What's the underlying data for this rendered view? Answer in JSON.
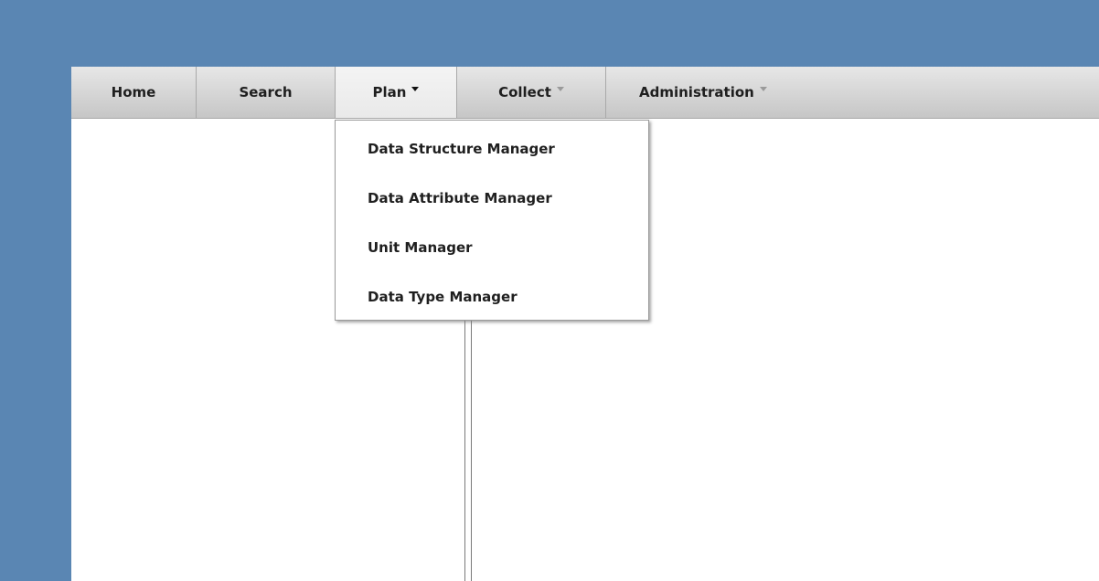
{
  "menubar": {
    "items": [
      {
        "label": "Home"
      },
      {
        "label": "Search"
      },
      {
        "label": "Plan"
      },
      {
        "label": "Collect"
      },
      {
        "label": "Administration"
      }
    ]
  },
  "dropdown": {
    "items": [
      {
        "label": "Data Structure Manager"
      },
      {
        "label": "Data Attribute Manager"
      },
      {
        "label": "Unit Manager"
      },
      {
        "label": "Data Type Manager"
      }
    ]
  },
  "icons": {
    "plan_caret": "caret-down-icon",
    "collect_caret": "caret-down-icon",
    "administration_caret": "caret-down-icon"
  }
}
